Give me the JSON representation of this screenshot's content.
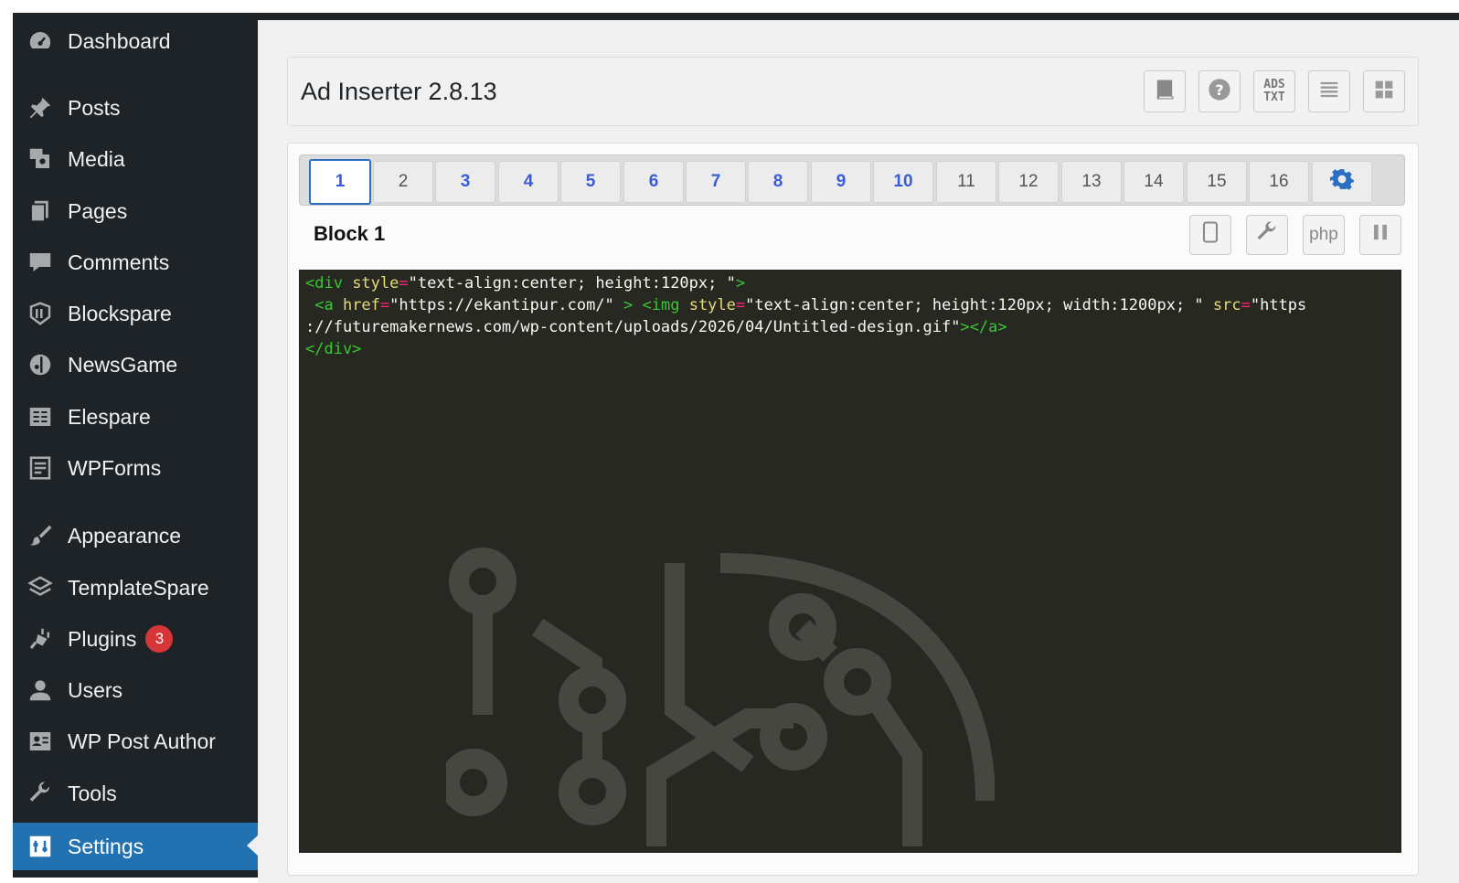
{
  "sidebar": {
    "items": [
      {
        "label": "Dashboard",
        "icon": "dashboard-icon"
      },
      {
        "label": "Posts",
        "icon": "pin-icon"
      },
      {
        "label": "Media",
        "icon": "media-icon"
      },
      {
        "label": "Pages",
        "icon": "pages-icon"
      },
      {
        "label": "Comments",
        "icon": "comment-icon"
      },
      {
        "label": "Blockspare",
        "icon": "blockspare-icon"
      },
      {
        "label": "NewsGame",
        "icon": "newsgame-icon"
      },
      {
        "label": "Elespare",
        "icon": "elespare-icon"
      },
      {
        "label": "WPForms",
        "icon": "wpforms-icon"
      },
      {
        "label": "Appearance",
        "icon": "brush-icon"
      },
      {
        "label": "TemplateSpare",
        "icon": "templatespare-icon"
      },
      {
        "label": "Plugins",
        "icon": "plugin-icon",
        "badge": "3"
      },
      {
        "label": "Users",
        "icon": "user-icon"
      },
      {
        "label": "WP Post Author",
        "icon": "author-icon"
      },
      {
        "label": "Tools",
        "icon": "wrench-icon"
      },
      {
        "label": "Settings",
        "icon": "settings-icon",
        "active": true
      }
    ]
  },
  "header": {
    "title": "Ad Inserter 2.8.13",
    "buttons": [
      "book-icon",
      "help-icon",
      "ads-txt-icon",
      "list-icon",
      "grid-icon"
    ],
    "ads_txt_line1": "ADS",
    "ads_txt_line2": "TXT"
  },
  "tabs": {
    "items": [
      "1",
      "2",
      "3",
      "4",
      "5",
      "6",
      "7",
      "8",
      "9",
      "10",
      "11",
      "12",
      "13",
      "14",
      "15",
      "16"
    ],
    "active": "1"
  },
  "block": {
    "title": "Block 1",
    "php_label": "php"
  },
  "editor": {
    "line1_tag": "<div",
    "line1_attr": " style",
    "line1_val": "\"text-align:center; height:120px; \"",
    "line1_end": ">",
    "line2_tag": " <a",
    "line2_attr1": " href",
    "line2_val1": "\"https://ekantipur.com/\"",
    "line2_gt": " >",
    "line2_img": " <img",
    "line2_attr2": " style",
    "line2_val2": "\"text-align:center; height:120px; width:1200px; \"",
    "line2_attr3": " src",
    "line2_val3a": "\"https",
    "line3_val3b": "://futuremakernews.com/wp-content/uploads/2026/04/Untitled-design.gif\"",
    "line3_end": "></a>",
    "line4": "</div>"
  },
  "colors": {
    "sidebar_bg": "#1d2327",
    "active_blue": "#2271b1",
    "badge_red": "#d63638",
    "tab_blue": "#3b5bd6",
    "editor_bg": "#272822"
  }
}
